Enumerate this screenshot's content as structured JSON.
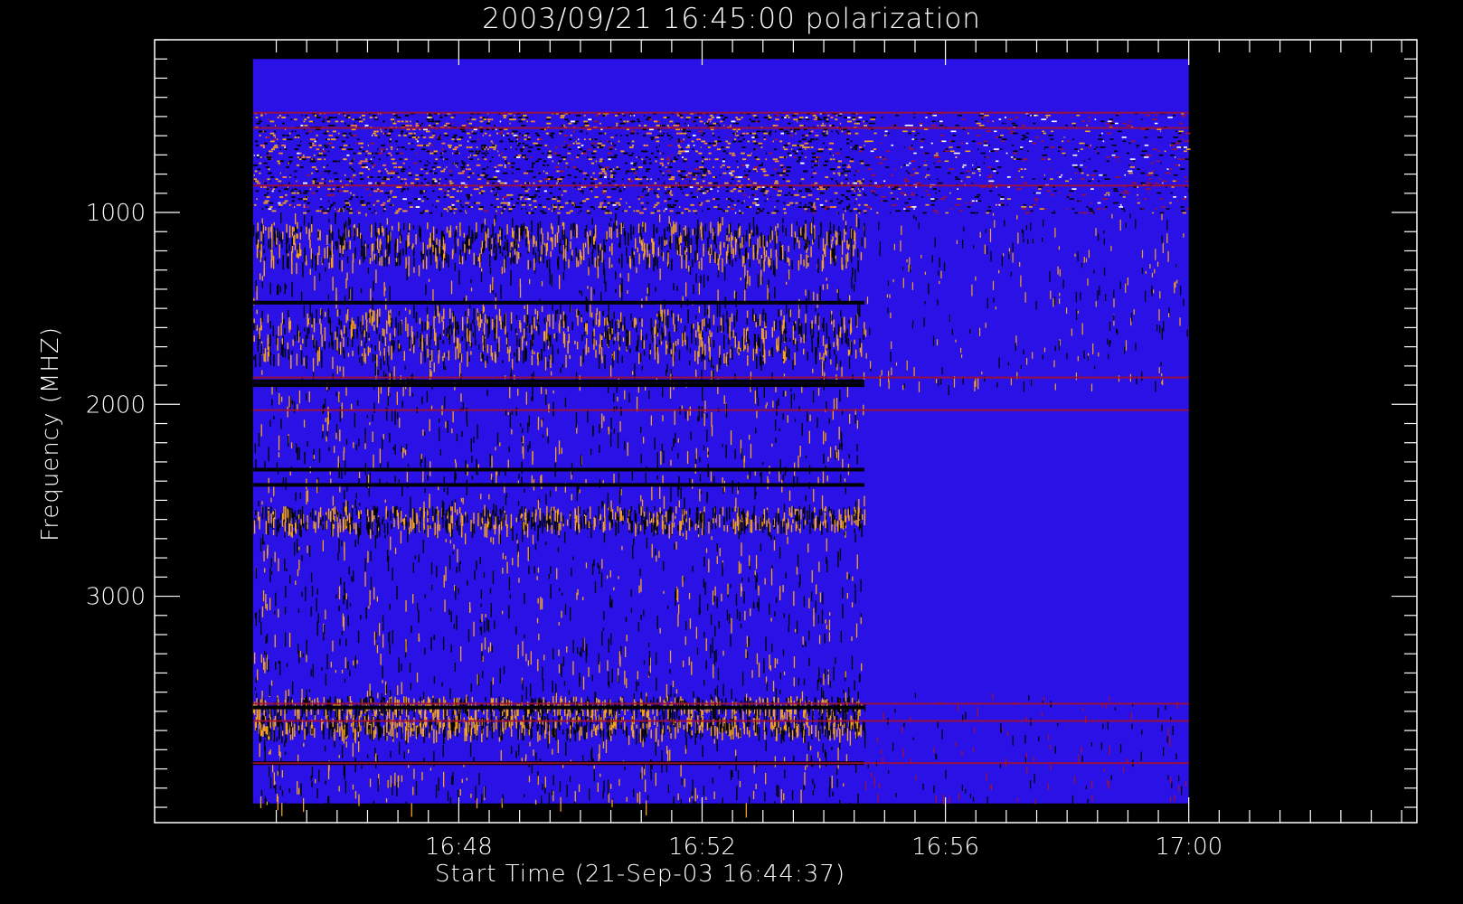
{
  "chart_data": {
    "type": "heatmap",
    "title": "2003/09/21 16:45:00 polarization",
    "xlabel": "Start Time (21-Sep-03 16:44:37)",
    "ylabel": "Frequency (MHZ)",
    "x_axis": {
      "unit": "time of day (UT)",
      "range": [
        "16:43:00",
        "17:03:45"
      ],
      "data_range": [
        "16:44:37",
        "17:00:00"
      ],
      "major_ticks": [
        "16:48",
        "16:52",
        "16:56",
        "17:00"
      ],
      "minor_tick_step": "00:30"
    },
    "y_axis": {
      "unit": "MHz",
      "range": [
        100,
        4180
      ],
      "data_range": [
        200,
        4080
      ],
      "inverted": true,
      "major_ticks": [
        1000,
        2000,
        3000
      ],
      "minor_tick_step": 100
    },
    "colormap": [
      "#2a11e6",
      "#000000",
      "#f5a31f",
      "#ff7a3d",
      "#a3122e",
      "#ffffff"
    ],
    "background_color": "#2a11e6",
    "regions": {
      "quiet_band_top": [
        200,
        480
      ],
      "dense_upper_band": [
        480,
        1000
      ],
      "activity_end_time": "16:54:40",
      "dark_stripes_mhz": [
        1470,
        1880,
        1900,
        2340,
        2420,
        3580,
        3870
      ],
      "orange_dense_bands_mhz": [
        [
          1050,
          1250
        ],
        [
          1500,
          1750
        ],
        [
          2530,
          2630
        ],
        [
          3520,
          3600
        ],
        [
          3620,
          3700
        ]
      ],
      "red_continuous_lines_mhz": [
        480,
        560,
        860,
        1860,
        2030,
        3560,
        3650,
        3870
      ]
    }
  },
  "labels": {
    "title": "2003/09/21 16:45:00 polarization",
    "xlabel": "Start Time (21-Sep-03 16:44:37)",
    "ylabel": "Frequency (MHZ)",
    "x_ticks": [
      "16:48",
      "16:52",
      "16:56",
      "17:00"
    ],
    "y_ticks": [
      "1000",
      "2000",
      "3000"
    ]
  }
}
